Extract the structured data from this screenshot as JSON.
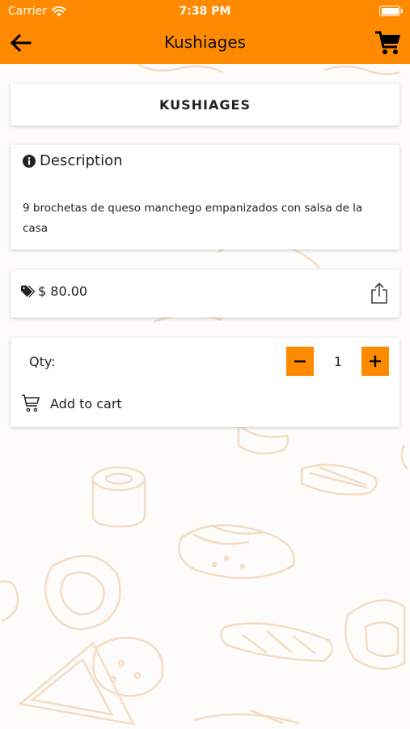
{
  "status_bar": {
    "carrier": "Carrier",
    "time": "7:38 PM"
  },
  "navbar": {
    "title": "Kushiages",
    "back_icon": "arrow-left-icon",
    "cart_icon": "shopping-cart-icon"
  },
  "product": {
    "name": "KUSHIAGES",
    "description_heading": "Description",
    "description_text": "9 brochetas de queso manchego empanizados con salsa de la casa",
    "price": "$ 80.00"
  },
  "cart": {
    "qty_label": "Qty:",
    "qty_value": "1",
    "add_to_cart_label": "Add to cart"
  },
  "colors": {
    "accent": "#ff8a00",
    "background_art": "#f3dcc3"
  }
}
